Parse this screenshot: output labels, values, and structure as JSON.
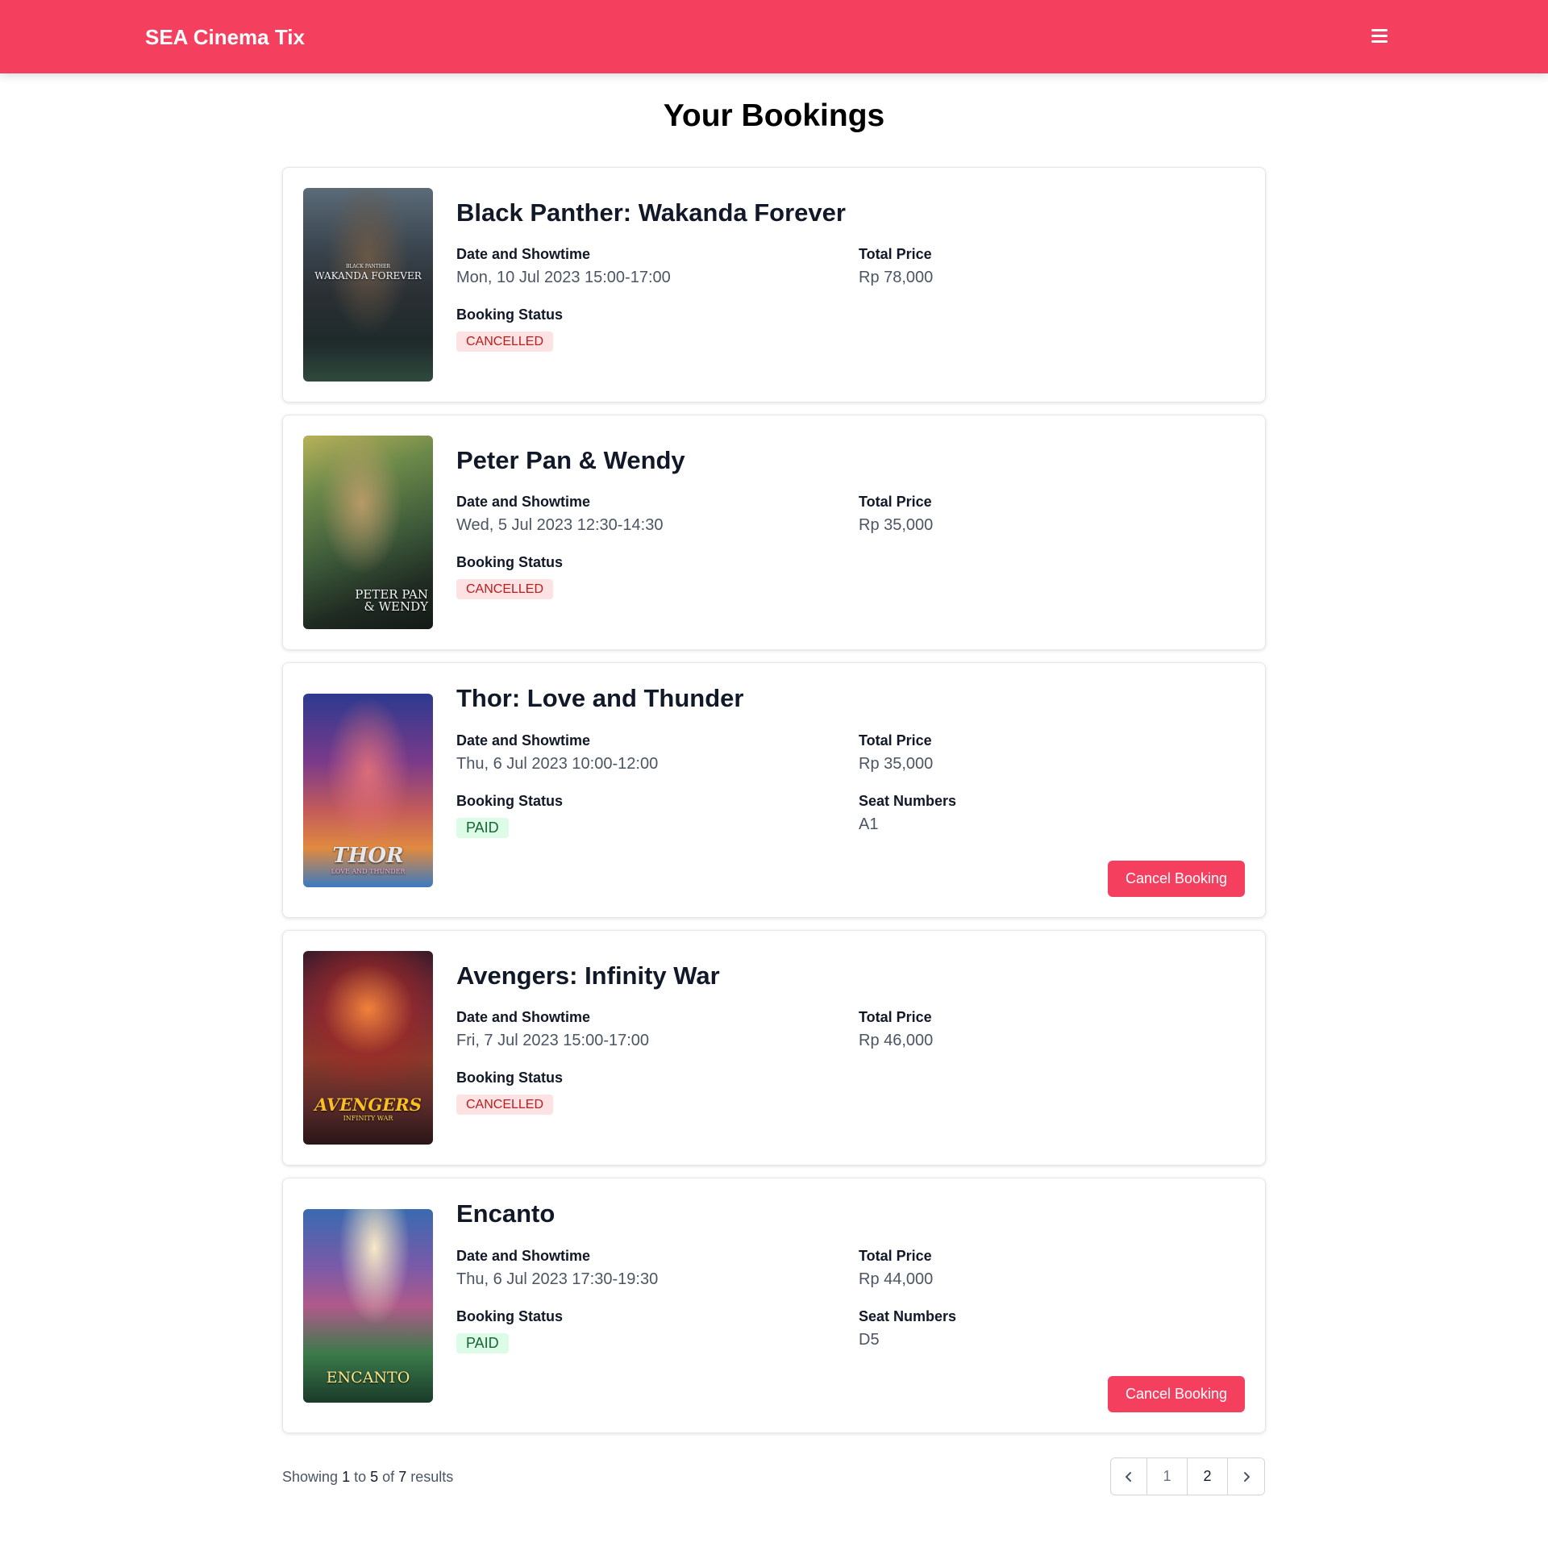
{
  "header": {
    "brand": "SEA Cinema Tix",
    "menu_icon": "hamburger-menu-icon",
    "background": "#f43f5e"
  },
  "page": {
    "title": "Your Bookings"
  },
  "labels": {
    "date_showtime": "Date and Showtime",
    "total_price": "Total Price",
    "booking_status": "Booking Status",
    "seat_numbers": "Seat Numbers",
    "cancel_button": "Cancel Booking"
  },
  "bookings": [
    {
      "title": "Black Panther: Wakanda Forever",
      "poster_text_top": "BLACK PANTHER",
      "poster_text": "WAKANDA FOREVER",
      "showtime": "Mon, 10 Jul 2023 15:00-17:00",
      "price": "Rp 78,000",
      "status": "CANCELLED"
    },
    {
      "title": "Peter Pan & Wendy",
      "poster_text": "PETER PAN & WENDY",
      "showtime": "Wed, 5 Jul 2023 12:30-14:30",
      "price": "Rp 35,000",
      "status": "CANCELLED"
    },
    {
      "title": "Thor: Love and Thunder",
      "poster_text": "THOR",
      "poster_text_sub": "LOVE AND THUNDER",
      "showtime": "Thu, 6 Jul 2023 10:00-12:00",
      "price": "Rp 35,000",
      "status": "PAID",
      "seats": "A1"
    },
    {
      "title": "Avengers: Infinity War",
      "poster_text": "AVENGERS",
      "poster_text_sub": "INFINITY WAR",
      "showtime": "Fri, 7 Jul 2023 15:00-17:00",
      "price": "Rp 46,000",
      "status": "CANCELLED"
    },
    {
      "title": "Encanto",
      "poster_text": "ENCANTO",
      "showtime": "Thu, 6 Jul 2023 17:30-19:30",
      "price": "Rp 44,000",
      "status": "PAID",
      "seats": "D5"
    }
  ],
  "pagination": {
    "text_showing": "Showing",
    "from": "1",
    "text_to": "to",
    "to": "5",
    "text_of": "of",
    "total": "7",
    "text_results": "results",
    "pages": [
      "1",
      "2"
    ],
    "current_page": "2",
    "prev_icon": "chevron-left-icon",
    "next_icon": "chevron-right-icon"
  },
  "colors": {
    "accent": "#f43f5e",
    "cancelled_bg": "#fde2e4",
    "cancelled_text": "#b91c1c",
    "paid_bg": "#dcfce7",
    "paid_text": "#166534"
  }
}
